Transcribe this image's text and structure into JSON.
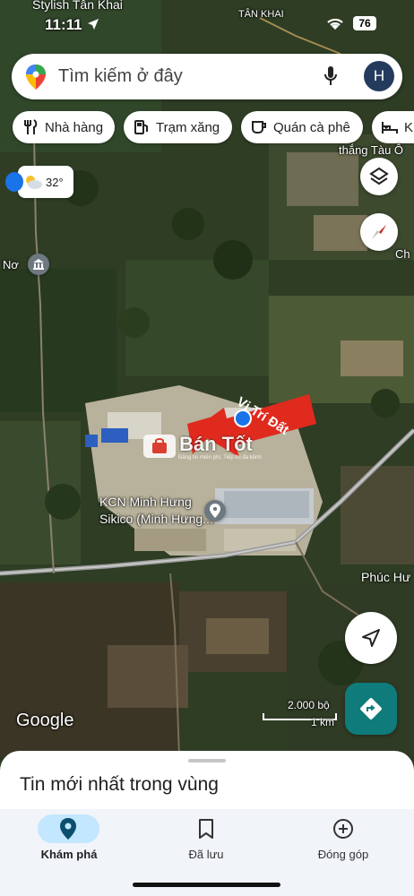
{
  "status_bar": {
    "carrier_text": "Stylish Tân Khai",
    "time": "11:11",
    "area_label": "TÂN KHAI",
    "battery": "76"
  },
  "search": {
    "placeholder": "Tìm kiếm ở đây",
    "avatar_letter": "H"
  },
  "chips": [
    {
      "label": "Nhà hàng",
      "icon": "restaurant-icon"
    },
    {
      "label": "Trạm xăng",
      "icon": "gas-station-icon"
    },
    {
      "label": "Quán cà phê",
      "icon": "coffee-icon"
    },
    {
      "label": "Kh",
      "icon": "hotel-icon"
    }
  ],
  "weather": {
    "temperature": "32°"
  },
  "map_labels": {
    "top_right_place": "thắng Tàu Ô",
    "right_edge_place": "Ch",
    "left_edge_place": "Nơ",
    "industrial_zone_line1": "KCN Minh Hưng",
    "industrial_zone_line2": "Sikico (Minh Hưng...",
    "lower_right_place": "Phúc Hư"
  },
  "annotation": {
    "arrow_label": "Vị Trí Đất",
    "colors": {
      "arrow": "#e02a1e",
      "dot": "#1a73e8"
    }
  },
  "watermark": {
    "brand": "Bán Tốt",
    "tagline": "Đăng tin miễn phí, Tiếp thị đa kênh"
  },
  "scale": {
    "upper": "2.000 bộ",
    "lower": "1 km"
  },
  "google_logo": "Google",
  "bottom_sheet": {
    "title": "Tin mới nhất trong vùng"
  },
  "bottom_nav": [
    {
      "label": "Khám phá",
      "icon": "explore-pin-icon",
      "active": true
    },
    {
      "label": "Đã lưu",
      "icon": "bookmark-icon",
      "active": false
    },
    {
      "label": "Đóng góp",
      "icon": "add-circle-icon",
      "active": false
    }
  ],
  "colors": {
    "accent": "#1a73e8",
    "directions": "#0f7b7b",
    "active_nav_bg": "#c2e7ff"
  }
}
